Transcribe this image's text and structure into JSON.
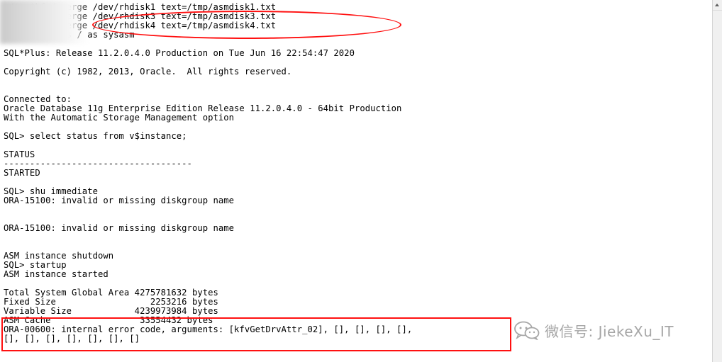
{
  "terminal": {
    "lines": [
      ":/tmp$kfed merge /dev/rhdisk1 text=/tmp/asmdisk1.txt",
      ":/tmp$kfed merge /dev/rhdisk3 text=/tmp/asmdisk3.txt",
      ":/tmp$kfed merge /dev/rhdisk4 text=/tmp/asmdisk4.txt",
      ":/tmp$sqlplus / as sysasm",
      "",
      "SQL*Plus: Release 11.2.0.4.0 Production on Tue Jun 16 22:54:47 2020",
      "",
      "Copyright (c) 1982, 2013, Oracle.  All rights reserved.",
      "",
      "",
      "Connected to:",
      "Oracle Database 11g Enterprise Edition Release 11.2.0.4.0 - 64bit Production",
      "With the Automatic Storage Management option",
      "",
      "SQL> select status from v$instance;",
      "",
      "STATUS",
      "------------------------------------",
      "STARTED",
      "",
      "SQL> shu immediate",
      "ORA-15100: invalid or missing diskgroup name",
      "",
      "",
      "ORA-15100: invalid or missing diskgroup name",
      "",
      "",
      "ASM instance shutdown",
      "SQL> startup",
      "ASM instance started",
      "",
      "Total System Global Area 4275781632 bytes",
      "Fixed Size                  2253216 bytes",
      "Variable Size            4239973984 bytes",
      "ASM Cache                 33554432 bytes",
      "ORA-00600: internal error code, arguments: [kfvGetDrvAttr_02], [], [], [], [],",
      "[], [], [], [], [], [], []"
    ]
  },
  "watermark": {
    "text": "微信号: JiekeXu_IT",
    "icon": "wechat-icon"
  },
  "colors": {
    "annotation_red": "#ff1010",
    "watermark_gray": "#a6a6a6"
  }
}
